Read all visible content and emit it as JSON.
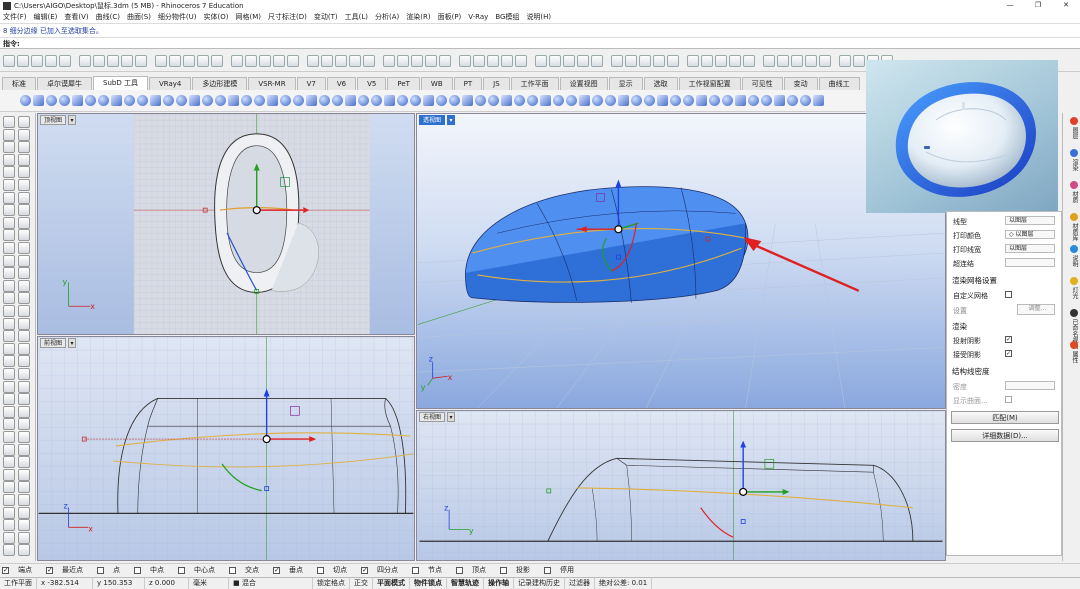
{
  "window": {
    "title": "C:\\Users\\AIGO\\Desktop\\鼠标.3dm (5 MB) - Rhinoceros 7 Education",
    "min": "—",
    "max": "❐",
    "close": "✕"
  },
  "menu": [
    "文件(F)",
    "编辑(E)",
    "查看(V)",
    "曲线(C)",
    "曲面(S)",
    "细分物件(U)",
    "实体(O)",
    "网格(M)",
    "尺寸标注(D)",
    "变动(T)",
    "工具(L)",
    "分析(A)",
    "渲染(R)",
    "面板(P)",
    "V-Ray",
    "BG模组",
    "说明(H)"
  ],
  "command": {
    "history": "8 细分边缘 已加入至选取集合。",
    "prompt": "指令:"
  },
  "tabs": [
    "标准",
    "卓尔谟犀牛",
    "SubD 工具",
    "VRay4",
    "多边形建模",
    "VSR-MR",
    "V7",
    "V6",
    "V5",
    "PeT",
    "WB",
    "PT",
    "JS",
    "工作平面",
    "设置视图",
    "显示",
    "选取",
    "工作视窗配置",
    "可见性",
    "变动",
    "曲线工"
  ],
  "active_tab_index": 2,
  "viewports": {
    "top": {
      "label": "顶视图",
      "menu": "▾",
      "axis_x": "x",
      "axis_y": "y"
    },
    "perspective": {
      "label": "透视图",
      "menu": "▾",
      "axis_x": "x",
      "axis_y": "y",
      "axis_z": "z"
    },
    "front": {
      "label": "前视图",
      "menu": "▾",
      "axis_x": "x",
      "axis_z": "z"
    },
    "right": {
      "label": "右视图",
      "menu": "▾",
      "axis_y": "y",
      "axis_z": "z"
    }
  },
  "properties": {
    "rows": [
      {
        "label": "线型",
        "value": "以图层"
      },
      {
        "label": "打印颜色",
        "value": "◇ 以图层"
      },
      {
        "label": "打印线宽",
        "value": "以图层"
      },
      {
        "label": "超连结",
        "value": ""
      }
    ],
    "render_mesh_title": "渲染网格设置",
    "custom_mesh_label": "自定义网格",
    "settings_label": "设置",
    "adjust_button": "调整...",
    "render_title": "渲染",
    "cast_shadow_label": "投射阴影",
    "receive_shadow_label": "接受阴影",
    "isocurve_title": "结构线密度",
    "density_label": "密度",
    "show_surface_label": "显示曲面...",
    "match_button": "匹配(M)",
    "details_button": "详细数据(D)..."
  },
  "side_tabs": [
    {
      "label": "图层",
      "color": "#e0402a"
    },
    {
      "label": "渲染",
      "color": "#3a6fd8"
    },
    {
      "label": "材质",
      "color": "#d04a8a"
    },
    {
      "label": "材质库",
      "color": "#e0a020"
    },
    {
      "label": "说明",
      "color": "#2a8ad8"
    },
    {
      "label": "灯光",
      "color": "#e0b020"
    },
    {
      "label": "已命名视图",
      "color": "#333333"
    },
    {
      "label": "属性",
      "color": "#e04a20"
    }
  ],
  "osnap": [
    {
      "label": "端点",
      "checked": true
    },
    {
      "label": "最近点",
      "checked": true
    },
    {
      "label": "点",
      "checked": false
    },
    {
      "label": "中点",
      "checked": false
    },
    {
      "label": "中心点",
      "checked": false
    },
    {
      "label": "交点",
      "checked": false
    },
    {
      "label": "垂点",
      "checked": true
    },
    {
      "label": "切点",
      "checked": false
    },
    {
      "label": "四分点",
      "checked": true
    },
    {
      "label": "节点",
      "checked": false
    },
    {
      "label": "顶点",
      "checked": false
    },
    {
      "label": "投影",
      "checked": false
    },
    {
      "label": "停用",
      "checked": false
    }
  ],
  "status": {
    "cplane": "工作平面",
    "x": "x -382.514",
    "y": "y 150.353",
    "z": "z 0.000",
    "unit": "毫米",
    "layer": "■ 混合",
    "items": [
      "锁定格点",
      "正交",
      "平面模式",
      "物件锁点",
      "智慧轨迹",
      "操作轴",
      "记录建构历史",
      "过滤器",
      "绝对公差: 0.01"
    ],
    "bold_items": [
      "平面模式",
      "物件锁点",
      "智慧轨迹",
      "操作轴"
    ]
  },
  "colors": {
    "accent_blue": "#2f6fd0",
    "subd_blue": "#4f8ff0",
    "viewport_bg": "#b7c7e6",
    "arrow_red": "#e02020"
  }
}
